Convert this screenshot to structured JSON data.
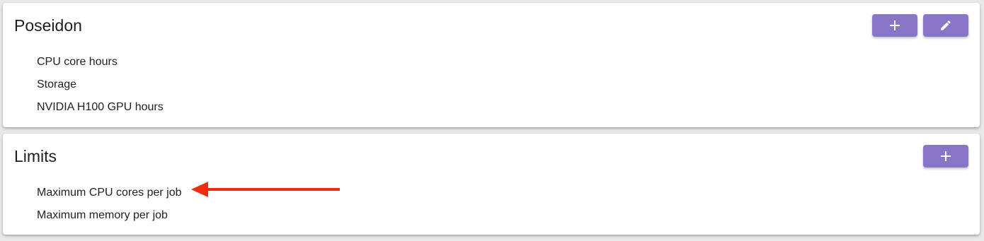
{
  "sections": [
    {
      "title": "Poseidon",
      "items": [
        "CPU core hours",
        "Storage",
        "NVIDIA H100 GPU hours"
      ],
      "actions": [
        {
          "icon": "plus-icon",
          "label": "add"
        },
        {
          "icon": "pencil-icon",
          "label": "edit"
        }
      ]
    },
    {
      "title": "Limits",
      "items": [
        "Maximum CPU cores per job",
        "Maximum memory per job"
      ],
      "actions": [
        {
          "icon": "plus-icon",
          "label": "add"
        }
      ]
    }
  ],
  "colors": {
    "button": "#8776c7",
    "arrow": "#f22a12",
    "background": "#e9e9ea"
  },
  "annotation": {
    "type": "red-arrow",
    "points_to": "Maximum CPU cores per job"
  }
}
